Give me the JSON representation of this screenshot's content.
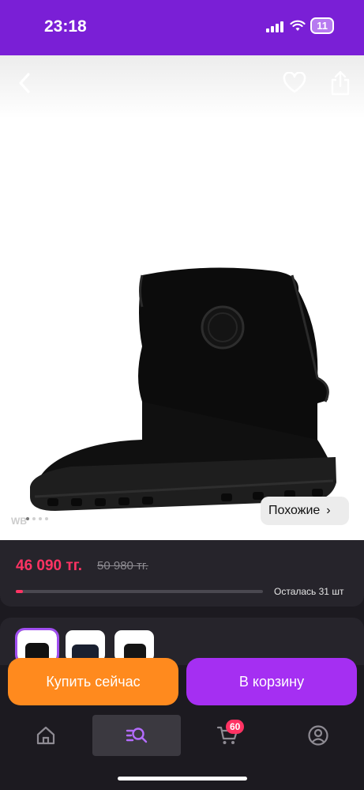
{
  "status": {
    "time": "23:18",
    "battery": "11"
  },
  "product": {
    "price": "46 090 тг.",
    "old_price": "50 980 тг.",
    "stock_text": "Осталась 31 шт",
    "stock_fraction": 0.03,
    "similar_label": "Похожие",
    "brand_mark": "WB"
  },
  "actions": {
    "buy_now": "Купить сейчас",
    "add_to_cart": "В корзину"
  },
  "tabbar": {
    "cart_count": "60",
    "active_tab": "catalog"
  },
  "colors": {
    "accent": "#7a1fd6",
    "price": "#ff3363",
    "buy": "#ff8a1e",
    "cart": "#a52ff2"
  },
  "icons": [
    "back-icon",
    "heart-icon",
    "share-icon",
    "home-icon",
    "catalog-search-icon",
    "cart-icon",
    "profile-icon"
  ]
}
